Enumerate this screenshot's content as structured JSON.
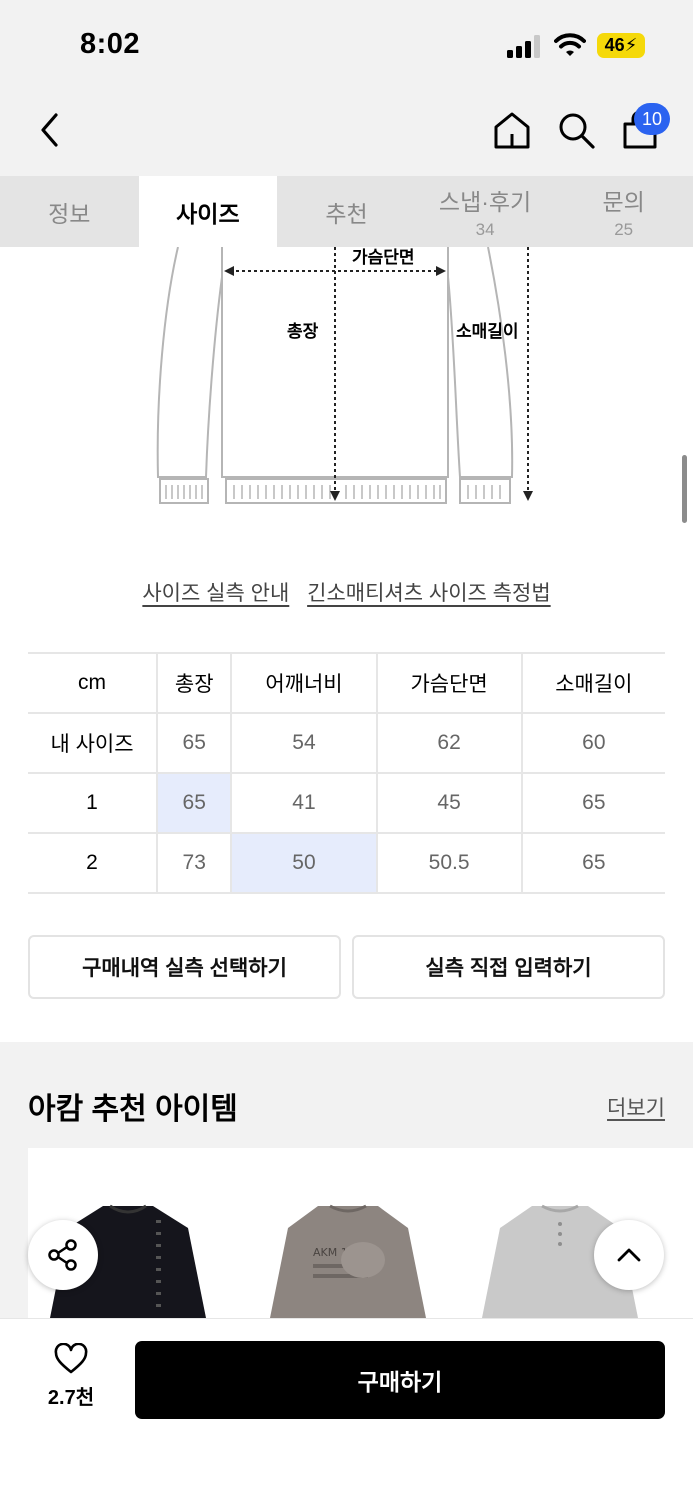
{
  "status_bar": {
    "time": "8:02",
    "battery": "46"
  },
  "header": {
    "cart_count": "10"
  },
  "tabs": [
    {
      "label": "정보",
      "count": ""
    },
    {
      "label": "사이즈",
      "count": ""
    },
    {
      "label": "추천",
      "count": ""
    },
    {
      "label": "스냅·후기",
      "count": "34"
    },
    {
      "label": "문의",
      "count": "25"
    }
  ],
  "diagram": {
    "chest": "가슴단면",
    "length": "총장",
    "sleeve": "소매길이"
  },
  "guide_links": {
    "guide": "사이즈 실측 안내",
    "method": "긴소매티셔츠 사이즈 측정법"
  },
  "size_table": {
    "headers": [
      "cm",
      "총장",
      "어깨너비",
      "가슴단면",
      "소매길이"
    ],
    "rows": [
      [
        "내 사이즈",
        "65",
        "54",
        "62",
        "60"
      ],
      [
        "1",
        "65",
        "41",
        "45",
        "65"
      ],
      [
        "2",
        "73",
        "50",
        "50.5",
        "65"
      ]
    ]
  },
  "actions": {
    "purchase_history": "구매내역 실측 선택하기",
    "manual_input": "실측 직접 입력하기"
  },
  "recommend": {
    "title": "아캄 추천 아이템",
    "more": "더보기"
  },
  "bottom": {
    "likes": "2.7천",
    "buy": "구매하기"
  },
  "colors": {
    "accent": "#2b63f0",
    "highlight": "#e6ecfc",
    "battery": "#f5d90a"
  }
}
